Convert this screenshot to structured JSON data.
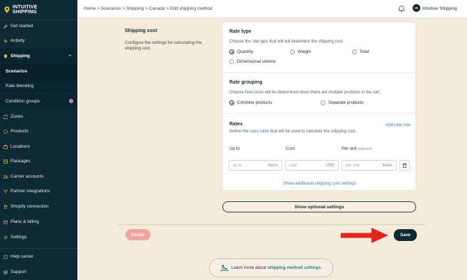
{
  "brand": {
    "line1": "INTUITIVE",
    "line2": "SHIPPING"
  },
  "sidebar": {
    "items": [
      {
        "label": "Get started",
        "icon": "rocket-icon"
      },
      {
        "label": "Activity",
        "icon": "activity-icon"
      },
      {
        "label": "Shipping",
        "icon": "shipping-icon"
      },
      {
        "label": "Scenarios"
      },
      {
        "label": "Rate blending"
      },
      {
        "label": "Condition groups",
        "badge": "!"
      },
      {
        "label": "Zones",
        "icon": "map-icon"
      },
      {
        "label": "Products",
        "icon": "tag-icon"
      },
      {
        "label": "Locations",
        "icon": "location-icon"
      },
      {
        "label": "Packages",
        "icon": "package-icon"
      },
      {
        "label": "Carrier accounts",
        "icon": "truck-icon"
      },
      {
        "label": "Partner integrations",
        "icon": "integration-icon"
      },
      {
        "label": "Shopify connection",
        "icon": "shopify-icon"
      },
      {
        "label": "Plans & billing",
        "icon": "billing-icon"
      },
      {
        "label": "Settings",
        "icon": "gear-icon"
      },
      {
        "label": "Help center",
        "icon": "book-icon"
      },
      {
        "label": "Support",
        "icon": "support-icon"
      }
    ]
  },
  "topbar": {
    "breadcrumb": "Home > Scenarios > Shipping > Canada > Edit shipping method",
    "avatar_initials": "IS",
    "account": "Intuitive Shipping"
  },
  "shipping_cost": {
    "title": "Shipping cost",
    "desc": "Configure the settings for calculating the shipping cost."
  },
  "rate_type": {
    "title": "Rate type",
    "desc": "Choose the rate type that will will determine the shipping cost.",
    "options": [
      "Quantity",
      "Weight",
      "Total",
      "Dimensional volume"
    ],
    "selected": "Quantity"
  },
  "rate_grouping": {
    "title": "Rate grouping",
    "desc": "Choose how costs will be determined when there are multiple products in the cart.",
    "options": [
      "Combine products",
      "Separate products"
    ],
    "selected": "Combine products"
  },
  "rates": {
    "title": "Rates",
    "add_link": "Add rate row",
    "desc_pre": "Define the ",
    "desc_link": "rates table",
    "desc_post": " that will be used to calculate the shipping cost.",
    "col_up_to": "Up to",
    "col_cost": "Cost",
    "col_per_unit": "Per unit",
    "col_per_unit_note": "(Optional)",
    "up_to_placeholder": "up to",
    "up_to_suffix": "items",
    "cost_placeholder": "cost",
    "cost_suffix": "USD",
    "per_unit_placeholder": "per unit",
    "per_unit_suffix": "items",
    "show_additional": "Show additional shipping cost settings"
  },
  "buttons": {
    "show_optional": "Show optional settings",
    "delete": "Delete",
    "save": "Save"
  },
  "learn_more": {
    "pre": "Learn more about ",
    "link": "shipping method settings",
    "post": "."
  },
  "colors": {
    "sidebar_bg": "#0d2a35",
    "page_bg": "#f5ebdb",
    "accent": "#2a8c9c",
    "delete": "#f0a59c",
    "arrow": "#e8231b"
  }
}
